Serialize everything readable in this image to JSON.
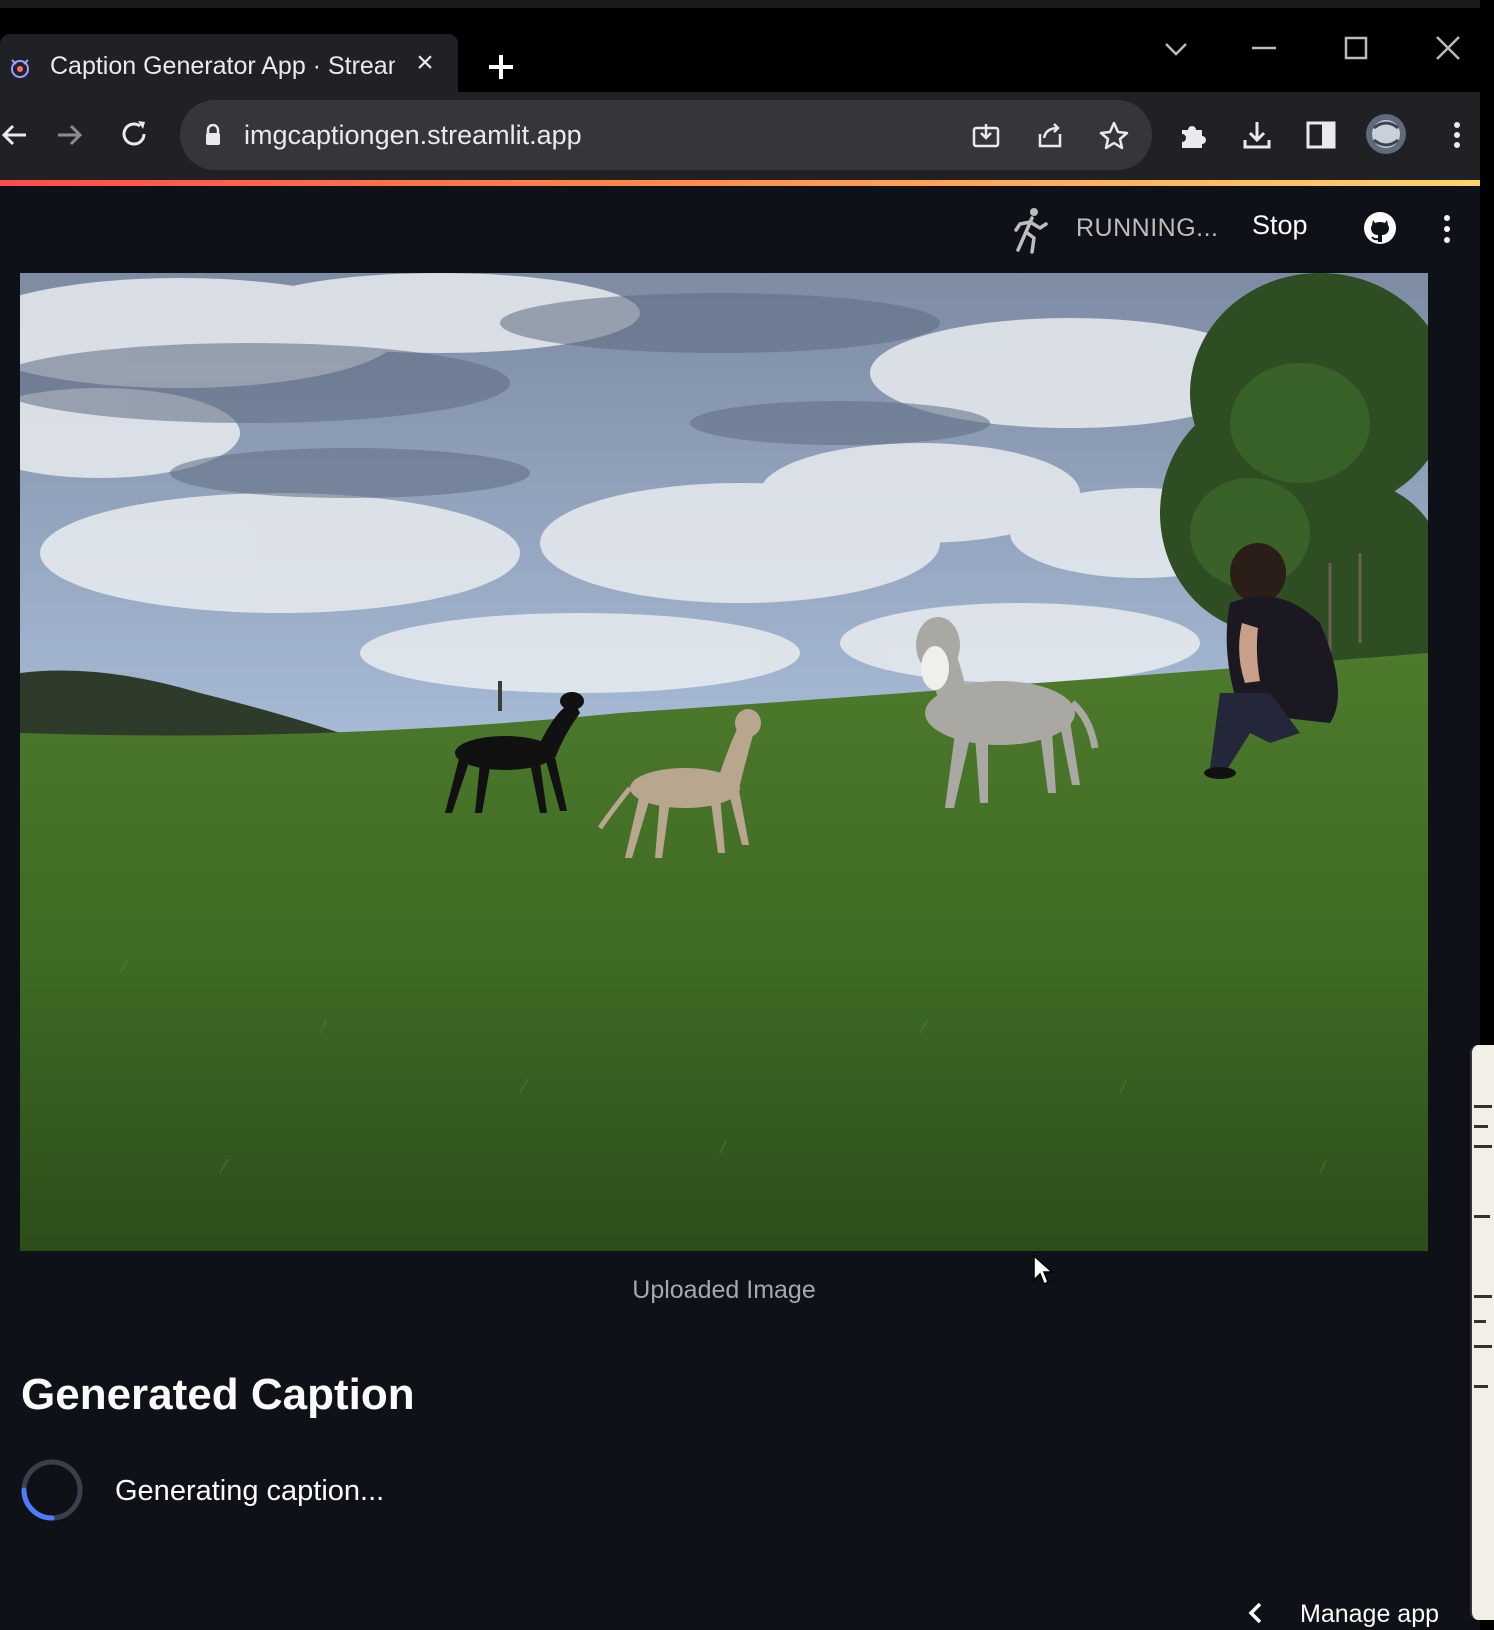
{
  "browser": {
    "tab_title": "Caption Generator App · Streamli",
    "url": "imgcaptiongen.streamlit.app"
  },
  "app": {
    "status_text": "RUNNING...",
    "stop_label": "Stop",
    "image_caption": "Uploaded Image",
    "section_title": "Generated Caption",
    "spinner_text": "Generating caption...",
    "manage_app_label": "Manage app"
  },
  "colors": {
    "accent": "#ff4b4b",
    "app_background": "#0e1117",
    "browser_toolbar": "#202124"
  },
  "icons": [
    "streamlit-favicon-icon",
    "close-icon",
    "plus-icon",
    "chevron-down-icon",
    "minimize-icon",
    "maximize-icon",
    "window-close-icon",
    "back-arrow-icon",
    "forward-arrow-icon",
    "reload-icon",
    "lock-icon",
    "install-icon",
    "share-icon",
    "star-icon",
    "extensions-icon",
    "download-icon",
    "side-panel-icon",
    "profile-avatar-icon",
    "kebab-menu-icon",
    "running-man-icon",
    "github-icon",
    "spinner-icon",
    "chevron-left-icon",
    "mouse-cursor-icon"
  ]
}
